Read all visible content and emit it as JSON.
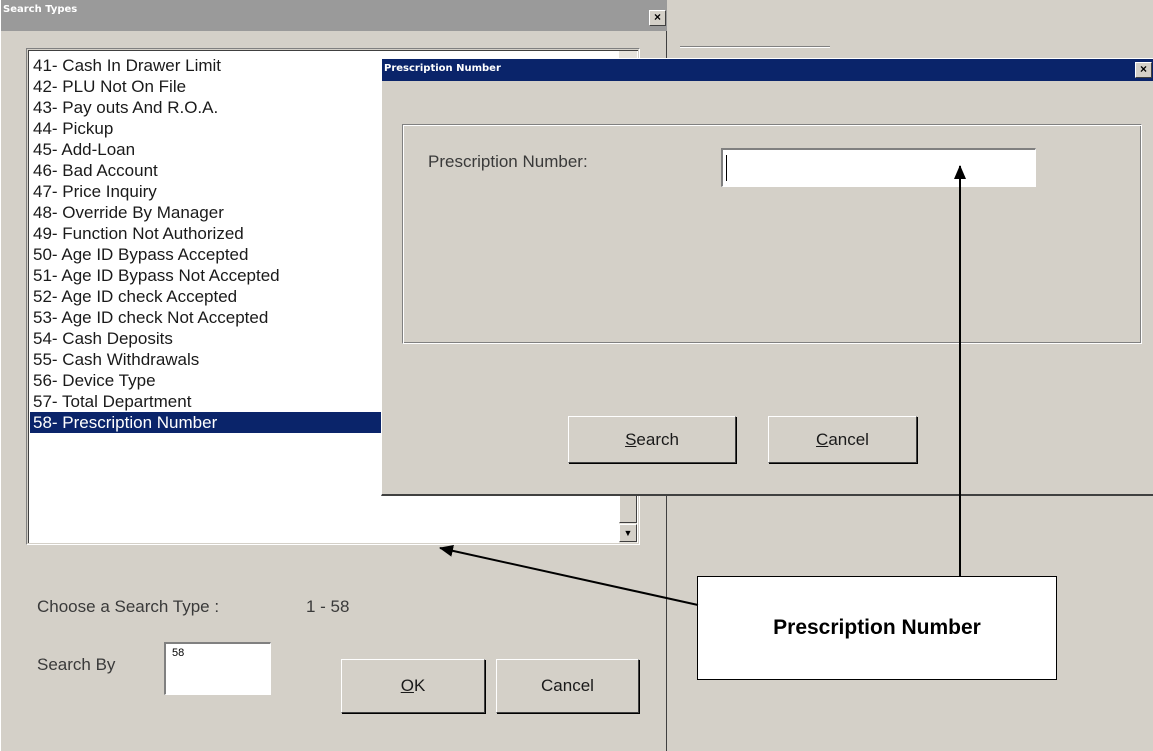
{
  "search_types_window": {
    "title": "Search Types",
    "close_glyph": "×",
    "list_items": [
      "41- Cash In Drawer Limit",
      "42- PLU Not On File",
      "43- Pay outs And R.O.A.",
      "44- Pickup",
      "45- Add-Loan",
      "46- Bad Account",
      "47- Price Inquiry",
      "48- Override By Manager",
      "49- Function Not Authorized",
      "50- Age ID Bypass Accepted",
      "51- Age ID Bypass Not Accepted",
      "52- Age ID check Accepted",
      "53- Age ID check Not Accepted",
      "54- Cash Deposits",
      "55- Cash Withdrawals",
      "56- Device Type",
      "57- Total Department",
      "58- Prescription Number"
    ],
    "selected_item": "58- Prescription Number",
    "choose_label": "Choose a Search Type :",
    "range_label": "1 - 58",
    "search_by_label": "Search By",
    "search_by_value": "58",
    "ok_label": "OK",
    "ok_mnemonic": "O",
    "cancel_label": "Cancel",
    "scroll_down_glyph": "▼"
  },
  "prescription_dialog": {
    "title": "Prescription Number",
    "close_glyph": "×",
    "field_label": "Prescription Number:",
    "field_value": "",
    "search_label": "Search",
    "search_mnemonic": "S",
    "cancel_label": "Cancel",
    "cancel_mnemonic": "C"
  },
  "callout": {
    "text": "Prescription Number"
  },
  "colors": {
    "window_bg": "#d4d0c8",
    "titlebar_gray": "#9a9a9a",
    "titlebar_blue": "#0a246a",
    "selection": "#0a246a"
  }
}
